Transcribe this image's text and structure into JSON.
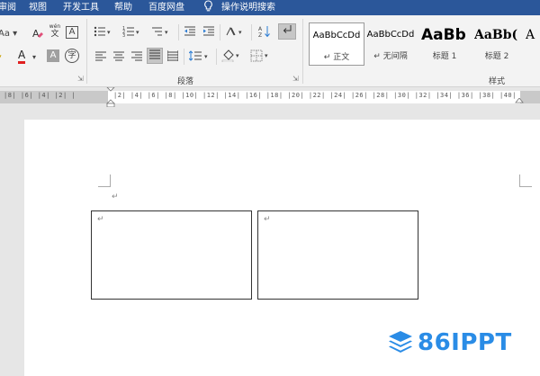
{
  "menu": {
    "items": [
      "审阅",
      "视图",
      "开发工具",
      "帮助",
      "百度网盘"
    ],
    "search_label": "操作说明搜索"
  },
  "ribbon": {
    "font_group": {
      "aa_label": "Aa",
      "phonetic_top": "wén",
      "phonetic_char": "文",
      "border_char": "A",
      "font_color_char": "A",
      "shade_char": "A",
      "circle_char": "字"
    },
    "paragraph_group": {
      "label": "段落"
    },
    "styles_group": {
      "label": "样式",
      "styles": [
        {
          "sample": "AaBbCcDd",
          "name": "↵ 正文",
          "selected": true
        },
        {
          "sample": "AaBbCcDd",
          "name": "↵ 无间隔",
          "selected": false
        },
        {
          "sample": "AaBb",
          "name": "标题 1",
          "selected": false
        },
        {
          "sample": "AaBb(",
          "name": "标题 2",
          "selected": false
        },
        {
          "sample": "A",
          "name": "",
          "selected": false
        }
      ]
    }
  },
  "ruler": {
    "left_text": "|8| |6| |4| |2| |",
    "right_text": "|2| |4| |6| |8| |10| |12| |14| |16| |18| |20| |22| |24| |26| |28| |30| |32| |34| |36| |38| |40|"
  },
  "document": {
    "paragraph_mark": "↵",
    "textbox1_mark": "↵",
    "textbox2_mark": "↵"
  },
  "watermark": {
    "text": "86IPPT",
    "color": "#2a8ce6"
  },
  "colors": {
    "title_bar": "#2b579a",
    "ribbon_bg": "#f3f3f3",
    "font_color_red": "#e02020"
  }
}
